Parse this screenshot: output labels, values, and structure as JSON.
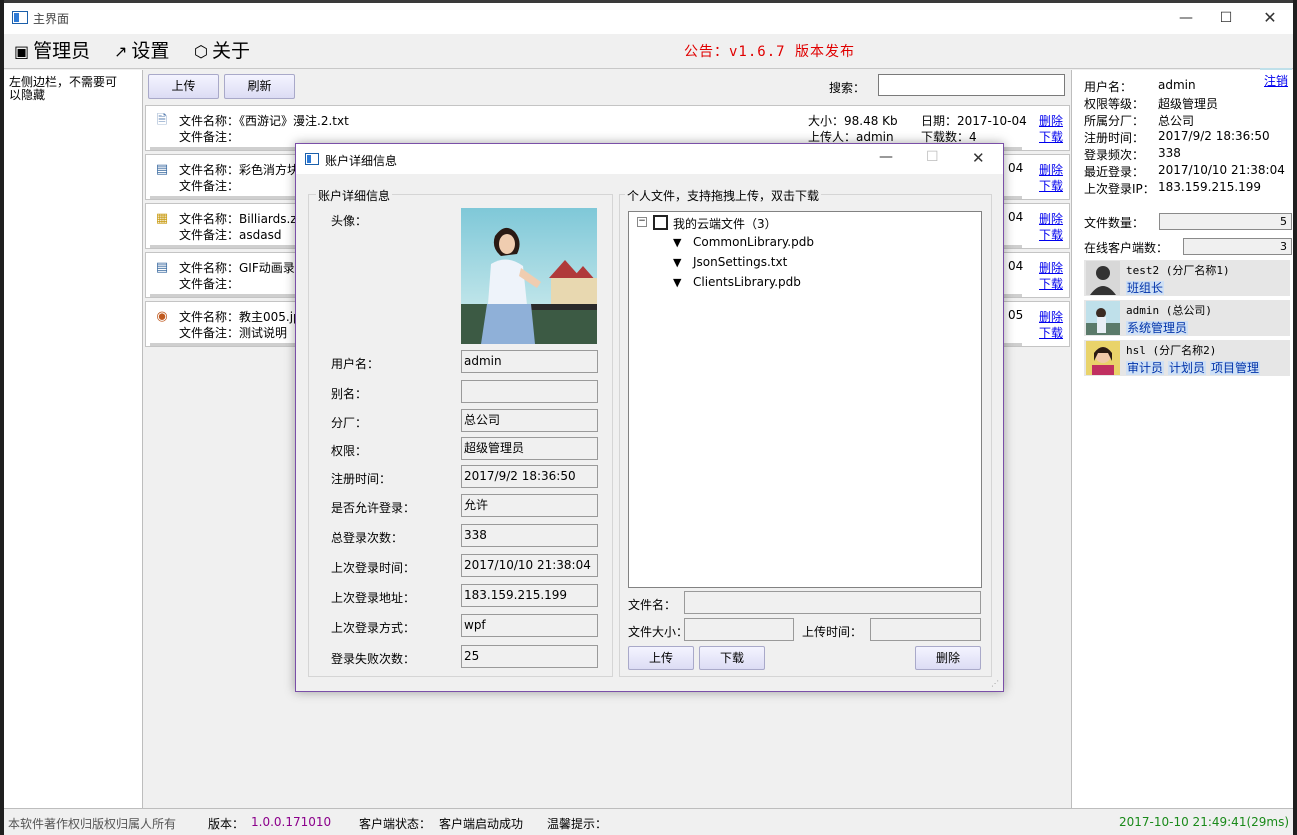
{
  "window": {
    "title": "主界面"
  },
  "menu": {
    "items": [
      "管理员",
      "设置",
      "关于"
    ],
    "notice": "公告：v1.6.7 版本发布"
  },
  "sidebar": {
    "text": "左侧边栏，不需要可以隐藏"
  },
  "toolbar": {
    "upload": "上传",
    "refresh": "刷新",
    "search_label": "搜索：",
    "search_value": ""
  },
  "files": [
    {
      "name": "文件名称：《西游记》漫注.2.txt",
      "note": "文件备注：",
      "size": "大小：98.48 Kb",
      "date": "日期：2017-10-04",
      "uploader": "上传人：admin",
      "downloads": "下载数：4",
      "delete": "删除",
      "download": "下载",
      "icon": "text-file-icon"
    },
    {
      "name": "文件名称：彩色消方块",
      "note": "文件备注：",
      "size": "",
      "date": "04",
      "uploader": "",
      "downloads": "",
      "delete": "删除",
      "download": "下载",
      "icon": "app-file-icon"
    },
    {
      "name": "文件名称：Billiards.zi",
      "note": "文件备注：asdasd",
      "size": "",
      "date": "04",
      "uploader": "",
      "downloads": "",
      "delete": "删除",
      "download": "下载",
      "icon": "archive-file-icon"
    },
    {
      "name": "文件名称：GIF动画录制",
      "note": "文件备注：",
      "size": "",
      "date": "04",
      "uploader": "",
      "downloads": "",
      "delete": "删除",
      "download": "下载",
      "icon": "app-file-icon"
    },
    {
      "name": "文件名称：教主005.jp",
      "note": "文件备注：测试说明",
      "size": "",
      "date": "05",
      "uploader": "",
      "downloads": "",
      "delete": "删除",
      "download": "下载",
      "icon": "image-file-icon"
    }
  ],
  "account": {
    "logout": "注销",
    "rows": [
      {
        "label": "用户名：",
        "value": "admin"
      },
      {
        "label": "权限等级：",
        "value": "超级管理员"
      },
      {
        "label": "所属分厂：",
        "value": "总公司"
      },
      {
        "label": "注册时间：",
        "value": "2017/9/2 18:36:50"
      },
      {
        "label": "登录频次：",
        "value": "338"
      },
      {
        "label": "最近登录：",
        "value": "2017/10/10 21:38:04"
      },
      {
        "label": "上次登录IP：",
        "value": "183.159.215.199"
      }
    ],
    "file_count_label": "文件数量：",
    "file_count": "5",
    "online_label": "在线客户端数：",
    "online_count": "3"
  },
  "online_users": [
    {
      "name": "test2 (分厂名称1)",
      "roles": [
        "班组长"
      ]
    },
    {
      "name": "admin (总公司)",
      "roles": [
        "系统管理员"
      ]
    },
    {
      "name": "hsl (分厂名称2)",
      "roles": [
        "审计员",
        "计划员",
        "项目管理"
      ]
    }
  ],
  "status": {
    "copyright": "本软件著作权归版权归属人所有",
    "version_label": "版本：",
    "version": "1.0.0.171010",
    "client_label": "客户端状态：",
    "client_status": "客户端启动成功",
    "tips_label": "温馨提示：",
    "time": "2017-10-10 21:49:41(29ms)"
  },
  "dialog": {
    "title": "账户详细信息",
    "left_group": "账户详细信息",
    "avatar_label": "头像：",
    "fields": [
      {
        "label": "用户名：",
        "value": "admin"
      },
      {
        "label": "别名：",
        "value": ""
      },
      {
        "label": "分厂：",
        "value": "总公司"
      },
      {
        "label": "权限：",
        "value": "超级管理员"
      },
      {
        "label": "注册时间：",
        "value": "2017/9/2 18:36:50"
      },
      {
        "label": "是否允许登录：",
        "value": "允许"
      },
      {
        "label": "总登录次数：",
        "value": "338"
      },
      {
        "label": "上次登录时间：",
        "value": "2017/10/10 21:38:04"
      },
      {
        "label": "上次登录地址：",
        "value": "183.159.215.199"
      },
      {
        "label": "上次登录方式：",
        "value": "wpf"
      },
      {
        "label": "登录失败次数：",
        "value": "25"
      }
    ],
    "right_group": "个人文件，支持拖拽上传，双击下载",
    "tree_root": "我的云端文件（3）",
    "tree_items": [
      "CommonLibrary.pdb",
      "JsonSettings.txt",
      "ClientsLibrary.pdb"
    ],
    "filename_label": "文件名：",
    "filesize_label": "文件大小：",
    "uploadtime_label": "上传时间：",
    "upload": "上传",
    "download": "下载",
    "delete": "删除"
  }
}
